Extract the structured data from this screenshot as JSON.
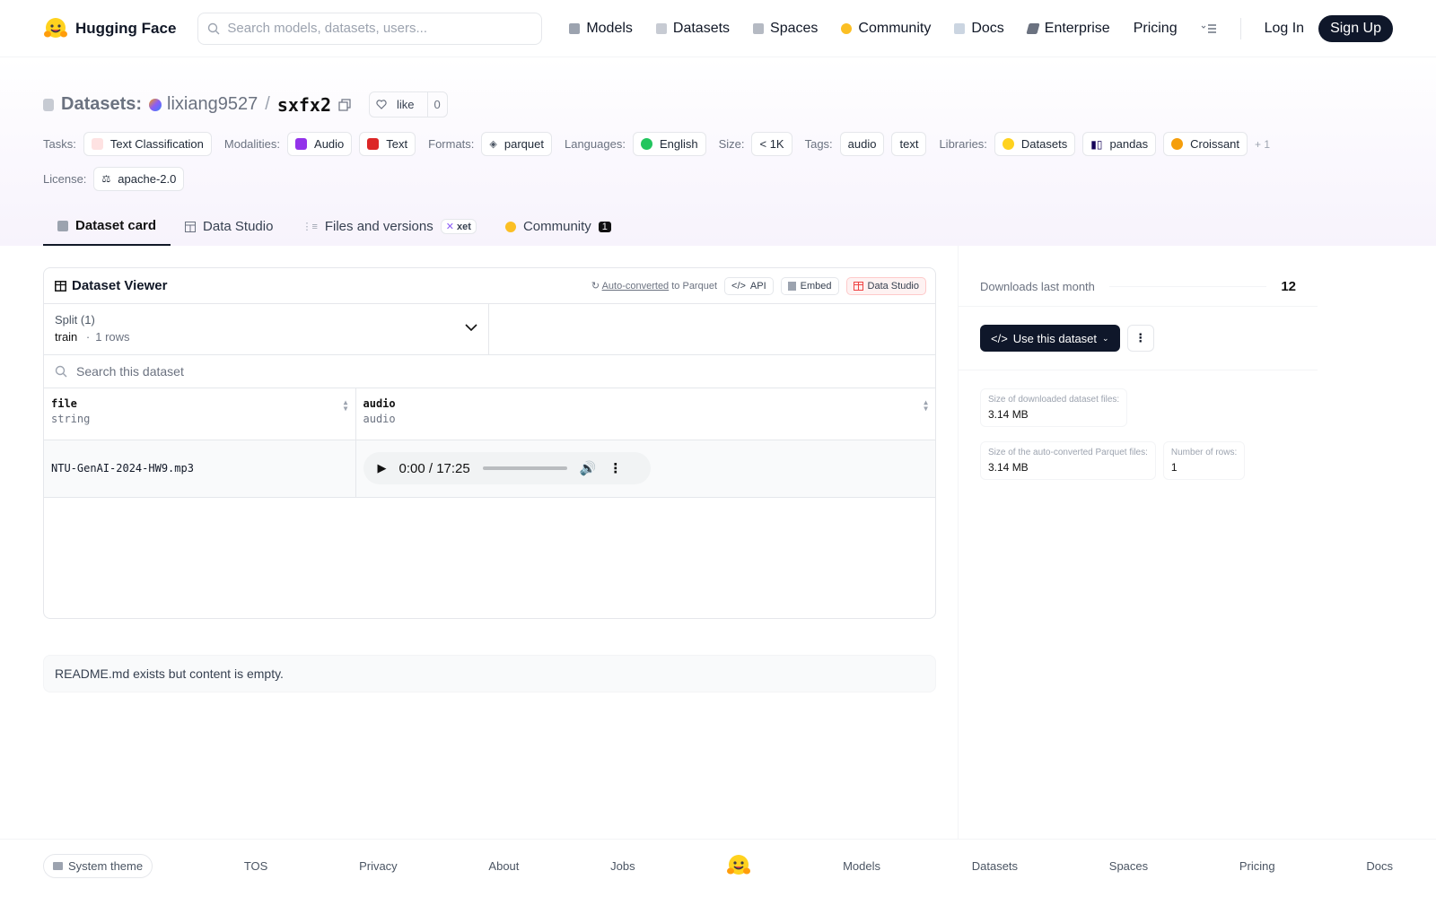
{
  "nav": {
    "brand": "Hugging Face",
    "search_placeholder": "Search models, datasets, users...",
    "links": [
      "Models",
      "Datasets",
      "Spaces",
      "Community",
      "Docs",
      "Enterprise",
      "Pricing"
    ],
    "login": "Log In",
    "signup": "Sign Up"
  },
  "repo": {
    "type_label": "Datasets:",
    "owner": "lixiang9527",
    "separator": "/",
    "name": "sxfx2",
    "like_label": "like",
    "like_count": "0"
  },
  "meta": {
    "tasks_label": "Tasks:",
    "tasks": [
      "Text Classification"
    ],
    "modalities_label": "Modalities:",
    "modalities": [
      "Audio",
      "Text"
    ],
    "formats_label": "Formats:",
    "formats": [
      "parquet"
    ],
    "languages_label": "Languages:",
    "languages": [
      "English"
    ],
    "size_label": "Size:",
    "size": "< 1K",
    "tags_label": "Tags:",
    "tags": [
      "audio",
      "text"
    ],
    "libraries_label": "Libraries:",
    "libraries": [
      "Datasets",
      "pandas",
      "Croissant"
    ],
    "more": "+ 1",
    "license_label": "License:",
    "license": "apache-2.0"
  },
  "tabs": [
    "Dataset card",
    "Data Studio",
    "Files and versions",
    "Community"
  ],
  "tabs_xet": "xet",
  "tabs_community_count": "1",
  "viewer": {
    "title": "Dataset Viewer",
    "auto_converted": "Auto-converted",
    "to_parquet": "to Parquet",
    "api": "API",
    "embed": "Embed",
    "data_studio": "Data Studio",
    "split_label": "Split (1)",
    "split_value": "train",
    "split_dot": "·",
    "split_rows": "1 rows",
    "search_placeholder": "Search this dataset",
    "columns": [
      {
        "name": "file",
        "type": "string"
      },
      {
        "name": "audio",
        "type": "audio"
      }
    ],
    "rows": [
      {
        "file": "NTU-GenAI-2024-HW9.mp3",
        "audio_time": "0:00 / 17:25"
      }
    ]
  },
  "readme": "README.md exists but content is empty.",
  "sidebar": {
    "downloads_label": "Downloads last month",
    "downloads_value": "12",
    "use_label": "Use this dataset",
    "size_files_label": "Size of downloaded dataset files:",
    "size_files_value": "3.14 MB",
    "size_parquet_label": "Size of the auto-converted Parquet files:",
    "size_parquet_value": "3.14 MB",
    "rows_label": "Number of rows:",
    "rows_value": "1"
  },
  "footer": {
    "theme": "System theme",
    "links": [
      "TOS",
      "Privacy",
      "About",
      "Jobs",
      "Models",
      "Datasets",
      "Spaces",
      "Pricing",
      "Docs"
    ]
  },
  "colors": {
    "accent_dark": "#0f172a",
    "hf_yellow": "#ffd21e"
  }
}
